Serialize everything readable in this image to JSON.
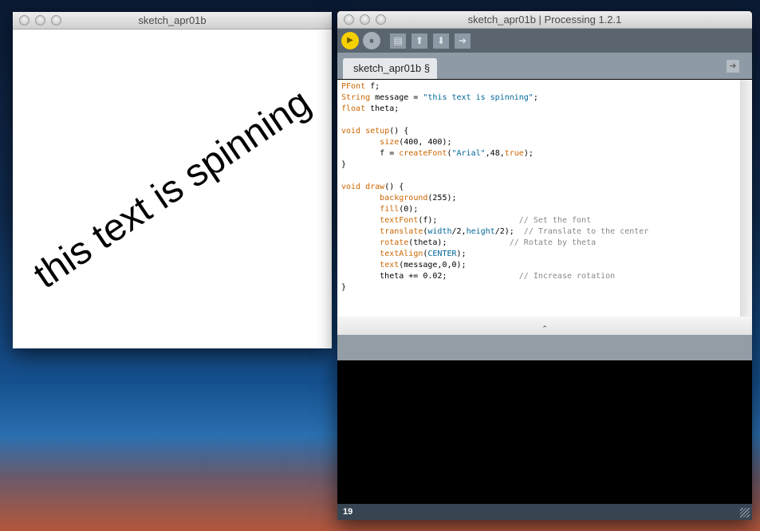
{
  "sketch_window": {
    "title": "sketch_apr01b",
    "canvas_text": "this text is spinning"
  },
  "ide_window": {
    "title": "sketch_apr01b | Processing 1.2.1",
    "toolbar": {
      "run": "run-icon",
      "stop": "stop-icon",
      "new": "new-icon",
      "open": "open-icon",
      "save": "save-icon",
      "export": "export-icon"
    },
    "tab_label": "sketch_apr01b §",
    "code": [
      [
        [
          "k",
          "PFont"
        ],
        [
          "p",
          " f;"
        ]
      ],
      [
        [
          "k",
          "String"
        ],
        [
          "p",
          " message = "
        ],
        [
          "s",
          "\"this text is spinning\""
        ],
        [
          "p",
          ";"
        ]
      ],
      [
        [
          "k",
          "float"
        ],
        [
          "p",
          " theta;"
        ]
      ],
      [],
      [
        [
          "k",
          "void"
        ],
        [
          "p",
          " "
        ],
        [
          "k",
          "setup"
        ],
        [
          "p",
          "() {"
        ]
      ],
      [
        [
          "p",
          "        "
        ],
        [
          "k",
          "size"
        ],
        [
          "p",
          "(400, 400);"
        ]
      ],
      [
        [
          "p",
          "        f = "
        ],
        [
          "k",
          "createFont"
        ],
        [
          "p",
          "("
        ],
        [
          "s",
          "\"Arial\""
        ],
        [
          "p",
          ",48,"
        ],
        [
          "k",
          "true"
        ],
        [
          "p",
          ");"
        ]
      ],
      [
        [
          "p",
          "}"
        ]
      ],
      [],
      [
        [
          "k",
          "void"
        ],
        [
          "p",
          " "
        ],
        [
          "k",
          "draw"
        ],
        [
          "p",
          "() {"
        ]
      ],
      [
        [
          "p",
          "        "
        ],
        [
          "k",
          "background"
        ],
        [
          "p",
          "(255);"
        ]
      ],
      [
        [
          "p",
          "        "
        ],
        [
          "k",
          "fill"
        ],
        [
          "p",
          "(0);"
        ]
      ],
      [
        [
          "p",
          "        "
        ],
        [
          "k",
          "textFont"
        ],
        [
          "p",
          "(f);                 "
        ],
        [
          "c",
          "// Set the font"
        ]
      ],
      [
        [
          "p",
          "        "
        ],
        [
          "k",
          "translate"
        ],
        [
          "p",
          "("
        ],
        [
          "s",
          "width"
        ],
        [
          "p",
          "/2,"
        ],
        [
          "s",
          "height"
        ],
        [
          "p",
          "/2);  "
        ],
        [
          "c",
          "// Translate to the center"
        ]
      ],
      [
        [
          "p",
          "        "
        ],
        [
          "k",
          "rotate"
        ],
        [
          "p",
          "(theta);             "
        ],
        [
          "c",
          "// Rotate by theta"
        ]
      ],
      [
        [
          "p",
          "        "
        ],
        [
          "k",
          "textAlign"
        ],
        [
          "p",
          "("
        ],
        [
          "s",
          "CENTER"
        ],
        [
          "p",
          ");"
        ]
      ],
      [
        [
          "p",
          "        "
        ],
        [
          "k",
          "text"
        ],
        [
          "p",
          "(message,0,0);"
        ]
      ],
      [
        [
          "p",
          "        theta += 0.02;               "
        ],
        [
          "c",
          "// Increase rotation"
        ]
      ],
      [
        [
          "p",
          "}"
        ]
      ]
    ],
    "status_line": "19",
    "colors": {
      "keyword": "#cc6600",
      "constant": "#006699",
      "comment": "#888888",
      "run": "#f5d000"
    }
  }
}
